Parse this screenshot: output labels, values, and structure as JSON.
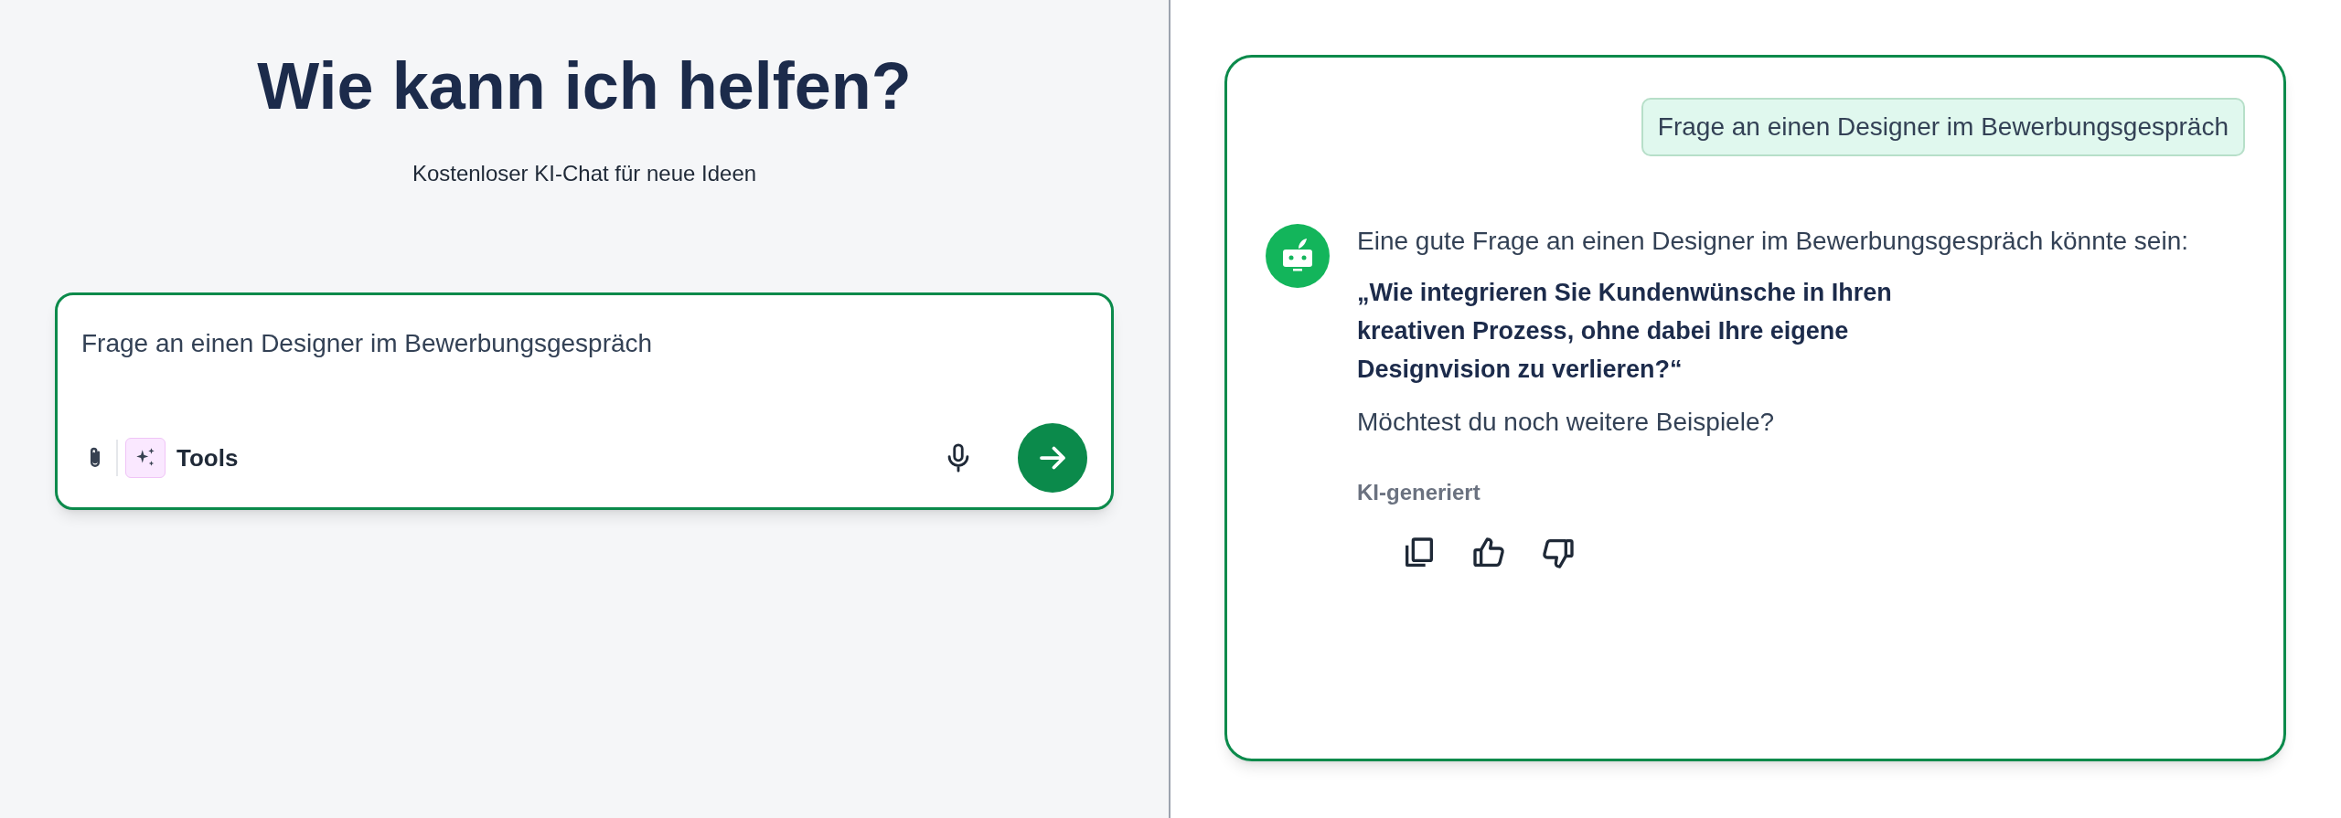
{
  "hero": {
    "title": "Wie kann ich helfen?",
    "subtitle": "Kostenloser KI-Chat für neue Ideen"
  },
  "composer": {
    "value": "Frage an einen Designer im Bewerbungsgespräch",
    "tools_label": "Tools"
  },
  "chat": {
    "user_message": "Frage an einen Designer im Bewerbungsgespräch",
    "reply": {
      "intro": "Eine gute Frage an einen Designer im Bewerbungsgespräch könnte sein:",
      "quote": "„Wie integrieren Sie Kundenwünsche in Ihren kreativen Prozess, ohne dabei Ihre eigene Designvision zu verlieren?“",
      "follow_up": "Möchtest du noch weitere Beispiele?",
      "label": "KI-generiert"
    }
  }
}
